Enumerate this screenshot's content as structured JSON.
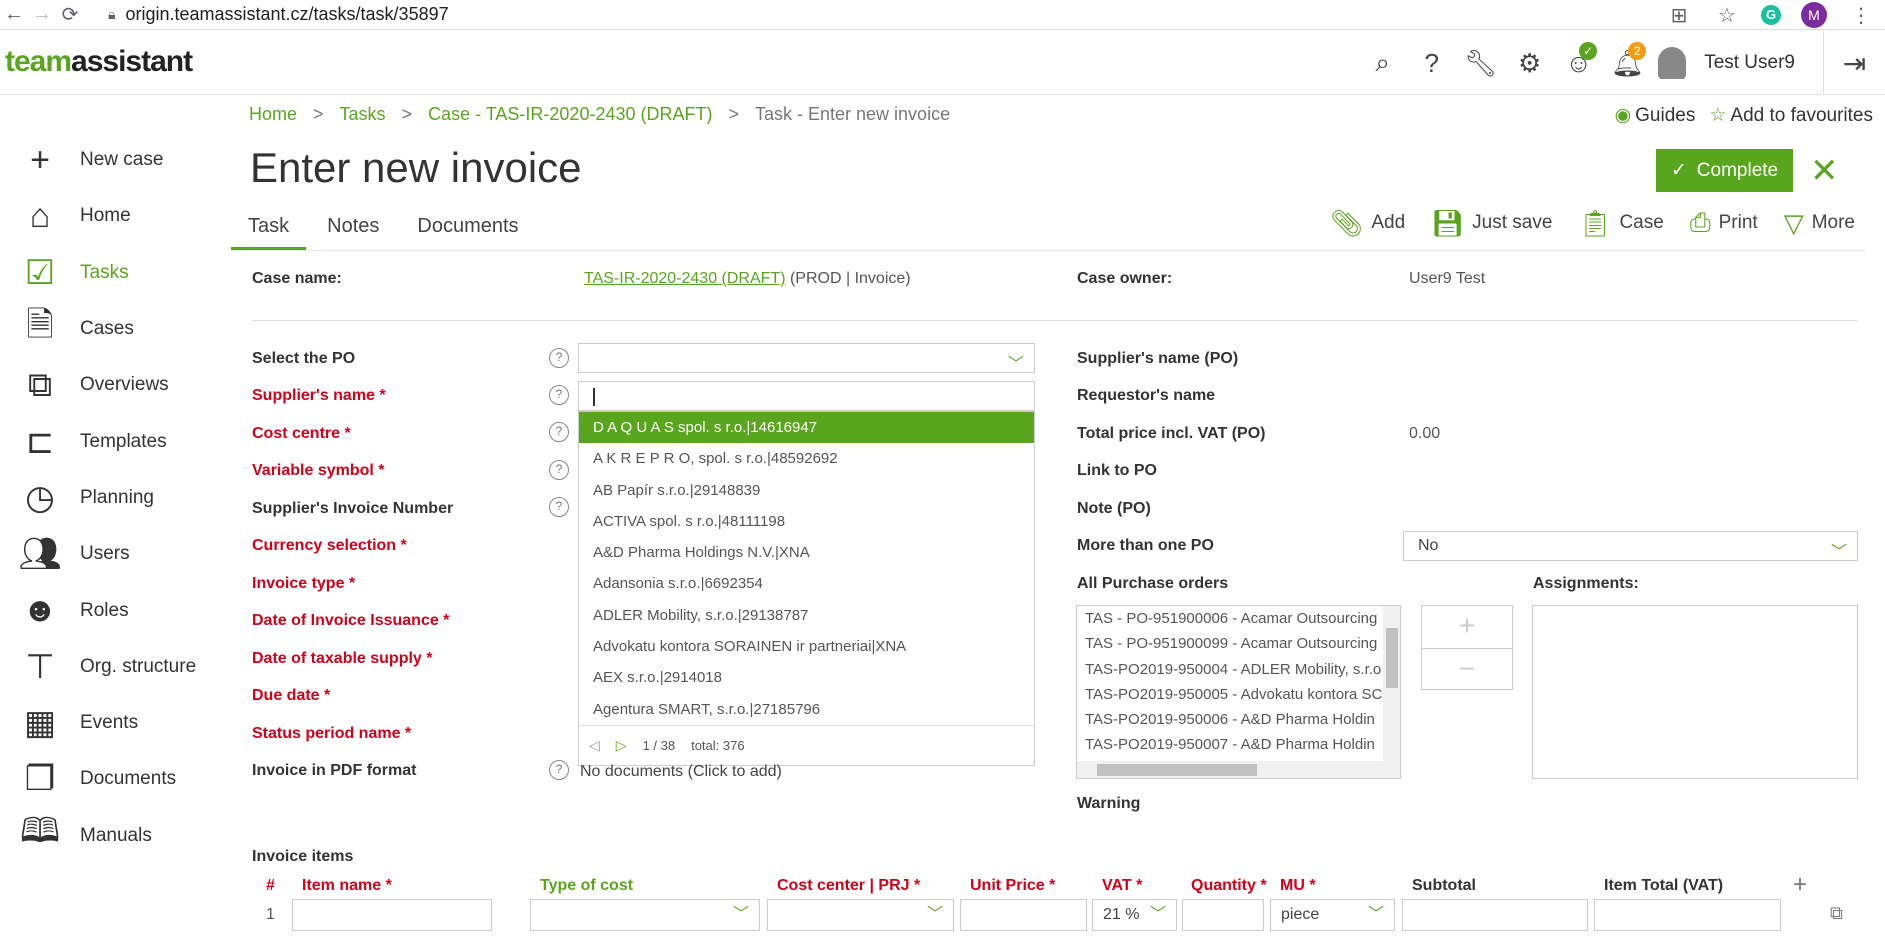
{
  "browser": {
    "url": "origin.teamassistant.cz/tasks/task/35897",
    "profile_initial": "M"
  },
  "header": {
    "logo_part1": "team",
    "logo_part2": "assistant",
    "user_name": "Test User9",
    "notifications_count": "2"
  },
  "sidebar": {
    "items": [
      {
        "label": "New case",
        "icon": "plus-icon"
      },
      {
        "label": "Home",
        "icon": "home-icon"
      },
      {
        "label": "Tasks",
        "icon": "tasks-icon"
      },
      {
        "label": "Cases",
        "icon": "cases-icon"
      },
      {
        "label": "Overviews",
        "icon": "overviews-icon"
      },
      {
        "label": "Templates",
        "icon": "templates-icon"
      },
      {
        "label": "Planning",
        "icon": "clock-icon"
      },
      {
        "label": "Users",
        "icon": "users-icon"
      },
      {
        "label": "Roles",
        "icon": "roles-icon"
      },
      {
        "label": "Org. structure",
        "icon": "org-structure-icon"
      },
      {
        "label": "Events",
        "icon": "calendar-icon"
      },
      {
        "label": "Documents",
        "icon": "documents-icon"
      },
      {
        "label": "Manuals",
        "icon": "manuals-icon"
      }
    ]
  },
  "breadcrumb": {
    "home": "Home",
    "tasks": "Tasks",
    "case": "Case - TAS-IR-2020-2430 (DRAFT)",
    "current": "Task - Enter new invoice",
    "sep": ">"
  },
  "top_links": {
    "guides": "Guides",
    "favourites": "Add to favourites"
  },
  "page": {
    "title": "Enter new invoice",
    "complete_label": "Complete"
  },
  "tabs": [
    "Task",
    "Notes",
    "Documents"
  ],
  "toolbar": {
    "add": "Add",
    "just_save": "Just save",
    "case": "Case",
    "print": "Print",
    "more": "More"
  },
  "form": {
    "case_name_label": "Case name:",
    "case_name_link": "TAS-IR-2020-2430 (DRAFT)",
    "case_name_suffix": " (PROD | Invoice)",
    "case_owner_label": "Case owner:",
    "case_owner_value": "User9 Test",
    "left_labels": {
      "select_po": "Select the PO",
      "supplier_name": "Supplier's name *",
      "cost_centre": "Cost centre *",
      "variable_symbol": "Variable symbol *",
      "supplier_invoice_number": "Supplier's Invoice Number",
      "currency_selection": "Currency selection *",
      "invoice_type": "Invoice type *",
      "date_issuance": "Date of Invoice Issuance *",
      "date_taxable": "Date of taxable supply *",
      "due_date": "Due date *",
      "status_period": "Status period name *",
      "invoice_pdf": "Invoice in PDF format"
    },
    "invoice_pdf_value": "No documents (Click to add)",
    "right_labels": {
      "supplier_name_po": "Supplier's name (PO)",
      "requestor_name": "Requestor's name",
      "total_price_po": "Total price incl. VAT (PO)",
      "link_to_po": "Link to PO",
      "note_po": "Note (PO)",
      "more_than_one_po": "More than one PO",
      "all_purchase_orders": "All Purchase orders",
      "assignments": "Assignments:",
      "warning": "Warning"
    },
    "total_price_value": "0.00",
    "more_than_one_po_value": "No"
  },
  "supplier_dropdown": {
    "options": [
      "D A Q U A S spol. s r.o.|14616947",
      "A K R E P R O, spol. s r.o.|48592692",
      "AB Papír s.r.o.|29148839",
      "ACTIVA spol. s r.o.|48111198",
      "A&D Pharma Holdings N.V.|XNA",
      "Adansonia s.r.o.|6692354",
      "ADLER Mobility, s.r.o.|29138787",
      "Advokatu kontora SORAINEN ir partneriai|XNA",
      "AEX s.r.o.|2914018",
      "Agentura SMART, s.r.o.|27185796"
    ],
    "page_info": "1 / 38",
    "total_info": "total: 376"
  },
  "purchase_orders": [
    "TAS - PO-951900006 - Acamar Outsourcing",
    "TAS - PO-951900099 - Acamar Outsourcing",
    "TAS-PO2019-950004 - ADLER Mobility, s.r.o",
    "TAS-PO2019-950005 - Advokatu kontora SC",
    "TAS-PO2019-950006 - A&D Pharma Holdin",
    "TAS-PO2019-950007 - A&D Pharma Holdin"
  ],
  "invoice_items": {
    "title": "Invoice items",
    "headers": {
      "num": "#",
      "item_name": "Item name *",
      "type_of_cost": "Type of cost",
      "cost_center": "Cost center | PRJ *",
      "unit_price": "Unit Price *",
      "vat": "VAT *",
      "quantity": "Quantity *",
      "mu": "MU *",
      "subtotal": "Subtotal",
      "item_total": "Item Total (VAT)"
    },
    "row1": {
      "num": "1",
      "vat": "21 %",
      "mu": "piece"
    }
  },
  "colors": {
    "accent": "#5aa51e",
    "required": "#d0021b"
  }
}
